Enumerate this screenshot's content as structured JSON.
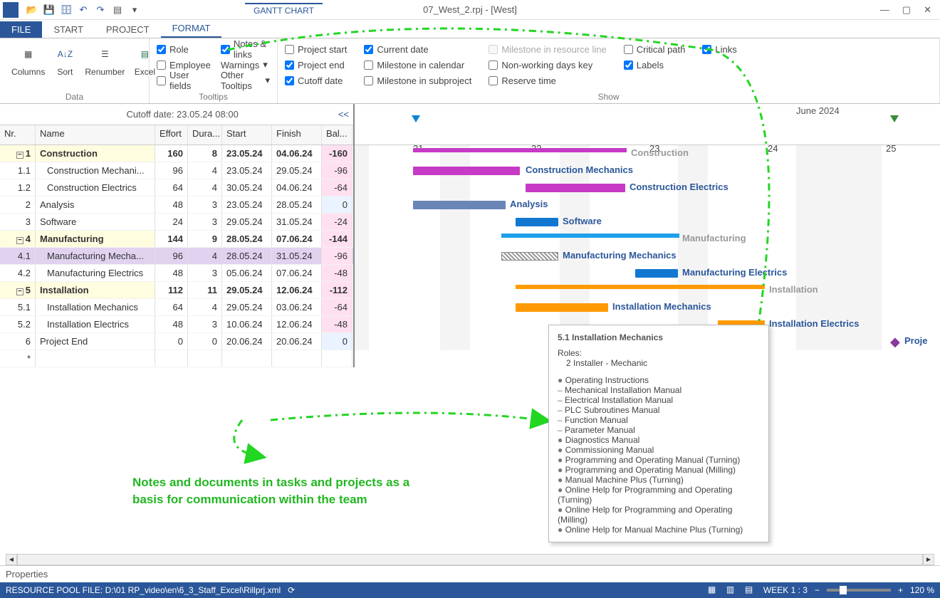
{
  "window": {
    "doc_title": "07_West_2.rpj - [West]",
    "tab_title": "GANTT CHART"
  },
  "tabs": {
    "file": "FILE",
    "start": "START",
    "project": "PROJECT",
    "format": "FORMAT"
  },
  "ribbon": {
    "data": {
      "label": "Data",
      "columns": "Columns",
      "sort": "Sort",
      "renumber": "Renumber",
      "excel": "Excel"
    },
    "tooltips": {
      "label": "Tooltips",
      "role": "Role",
      "employee": "Employee",
      "userfields": "User fields",
      "notes": "Notes & links",
      "warnings": "Warnings",
      "other": "Other Tooltips"
    },
    "show": {
      "label": "Show",
      "pstart": "Project start",
      "pend": "Project end",
      "cutoff": "Cutoff date",
      "cdate": "Current date",
      "mcal": "Milestone in calendar",
      "msub": "Milestone in subproject",
      "mres": "Milestone in resource line",
      "nw": "Non-working days key",
      "res": "Reserve time",
      "crit": "Critical path",
      "labels": "Labels",
      "links": "Links"
    }
  },
  "grid": {
    "cutoff": "Cutoff date: 23.05.24 08:00",
    "collapse": "<<",
    "headers": {
      "nr": "Nr.",
      "name": "Name",
      "effort": "Effort",
      "dura": "Dura...",
      "start": "Start",
      "finish": "Finish",
      "bal": "Bal..."
    },
    "rows": [
      {
        "nr": "1",
        "name": "Construction",
        "effort": "160",
        "dura": "8",
        "start": "23.05.24",
        "finish": "04.06.24",
        "bal": "-160",
        "bold": true,
        "exp": true
      },
      {
        "nr": "1.1",
        "name": "Construction Mechani...",
        "effort": "96",
        "dura": "4",
        "start": "23.05.24",
        "finish": "29.05.24",
        "bal": "-96",
        "ind": true
      },
      {
        "nr": "1.2",
        "name": "Construction Electrics",
        "effort": "64",
        "dura": "4",
        "start": "30.05.24",
        "finish": "04.06.24",
        "bal": "-64",
        "ind": true
      },
      {
        "nr": "2",
        "name": "Analysis",
        "effort": "48",
        "dura": "3",
        "start": "23.05.24",
        "finish": "28.05.24",
        "bal": "0"
      },
      {
        "nr": "3",
        "name": "Software",
        "effort": "24",
        "dura": "3",
        "start": "29.05.24",
        "finish": "31.05.24",
        "bal": "-24"
      },
      {
        "nr": "4",
        "name": "Manufacturing",
        "effort": "144",
        "dura": "9",
        "start": "28.05.24",
        "finish": "07.06.24",
        "bal": "-144",
        "bold": true,
        "exp": true
      },
      {
        "nr": "4.1",
        "name": "Manufacturing Mecha...",
        "effort": "96",
        "dura": "4",
        "start": "28.05.24",
        "finish": "31.05.24",
        "bal": "-96",
        "ind": true,
        "sel": true
      },
      {
        "nr": "4.2",
        "name": "Manufacturing Electrics",
        "effort": "48",
        "dura": "3",
        "start": "05.06.24",
        "finish": "07.06.24",
        "bal": "-48",
        "ind": true
      },
      {
        "nr": "5",
        "name": "Installation",
        "effort": "112",
        "dura": "11",
        "start": "29.05.24",
        "finish": "12.06.24",
        "bal": "-112",
        "bold": true,
        "exp": true
      },
      {
        "nr": "5.1",
        "name": "Installation Mechanics",
        "effort": "64",
        "dura": "4",
        "start": "29.05.24",
        "finish": "03.06.24",
        "bal": "-64",
        "ind": true
      },
      {
        "nr": "5.2",
        "name": "Installation Electrics",
        "effort": "48",
        "dura": "3",
        "start": "10.06.24",
        "finish": "12.06.24",
        "bal": "-48",
        "ind": true
      },
      {
        "nr": "6",
        "name": "Project End",
        "effort": "0",
        "dura": "0",
        "start": "20.06.24",
        "finish": "20.06.24",
        "bal": "0"
      },
      {
        "nr": "*",
        "name": "",
        "effort": "",
        "dura": "",
        "start": "",
        "finish": "",
        "bal": ""
      }
    ]
  },
  "timeline": {
    "month": "June 2024",
    "d21": "21",
    "d22": "22",
    "d23": "23",
    "d24": "24",
    "d25": "25"
  },
  "gantt_labels": {
    "construction": "Construction",
    "cmech": "Construction Mechanics",
    "celec": "Construction Electrics",
    "analysis": "Analysis",
    "software": "Software",
    "manufacturing": "Manufacturing",
    "mmech": "Manufacturing Mechanics",
    "melec": "Manufacturing Electrics",
    "installation": "Installation",
    "imech": "Installation Mechanics",
    "ielec": "Installation Electrics",
    "pend": "Proje"
  },
  "tooltip": {
    "title": "5.1 Installation Mechanics",
    "roles_h": "Roles:",
    "role1": "2 Installer - Mechanic",
    "items": [
      "Operating Instructions",
      "Mechanical Installation Manual",
      "Electrical Installation Manual",
      "PLC Subroutines Manual",
      "Function Manual",
      "Parameter Manual",
      "Diagnostics Manual",
      "Commissioning Manual",
      "Programming and Operating Manual (Turning)",
      "Programming and Operating Manual (Milling)",
      "Manual Machine Plus (Turning)",
      "Online Help for Programming and Operating (Turning)",
      "Online Help for Programming and Operating (Milling)",
      "Online Help for Manual Machine Plus (Turning)"
    ]
  },
  "annotation": {
    "l1": "Notes and documents in tasks and projects as a",
    "l2": "basis for communication within the team"
  },
  "props": "Properties",
  "status": {
    "file": "RESOURCE POOL FILE: D:\\01 RP_video\\en\\6_3_Staff_Excel\\Rillprj.xml",
    "week": "WEEK 1 : 3",
    "zoom": "120 %"
  }
}
